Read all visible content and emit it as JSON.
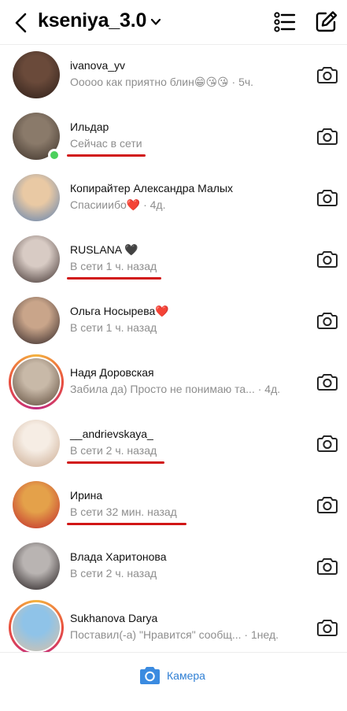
{
  "header": {
    "username": "kseniya_3.0",
    "back_icon": "chevron-left-icon",
    "list_icon": "list-icon",
    "compose_icon": "compose-icon"
  },
  "threads": [
    {
      "name": "ivanova_yv",
      "subtitle": "Ооооо как приятно блин😁😘😘 · 5ч.",
      "online": false,
      "story_ring": false,
      "underlined": false,
      "avatar_colors": [
        "#6a4a3a",
        "#2b1d18"
      ]
    },
    {
      "name": "Ильдар",
      "subtitle": "Сейчас в сети",
      "online": true,
      "story_ring": false,
      "underlined": true,
      "avatar_colors": [
        "#8a7a6a",
        "#3b3028"
      ]
    },
    {
      "name": "Копирайтер Александра Малых",
      "subtitle": "Спасииибо❤️ · 4д.",
      "online": false,
      "story_ring": false,
      "underlined": false,
      "avatar_colors": [
        "#e9c9a4",
        "#5a7fb1"
      ]
    },
    {
      "name": "RUSLANA 🖤",
      "subtitle": "В сети 1 ч. назад",
      "online": false,
      "story_ring": false,
      "underlined": true,
      "avatar_colors": [
        "#d8cbc4",
        "#3a2c2a"
      ]
    },
    {
      "name": "Ольга Носырева❤️",
      "subtitle": "В сети 1 ч. назад",
      "online": false,
      "story_ring": false,
      "underlined": false,
      "avatar_colors": [
        "#c9a58a",
        "#2d2224"
      ]
    },
    {
      "name": "Надя Доровская",
      "subtitle": "Забила да) Просто не понимаю та... · 4д.",
      "online": false,
      "story_ring": true,
      "underlined": false,
      "avatar_colors": [
        "#c8b9a8",
        "#5a4636"
      ]
    },
    {
      "name": "__andrievskaya_",
      "subtitle": "В сети 2 ч. назад",
      "online": false,
      "story_ring": false,
      "underlined": true,
      "avatar_colors": [
        "#f6ede4",
        "#c9a88e"
      ]
    },
    {
      "name": "Ирина",
      "subtitle": "В сети 32 мин. назад",
      "online": false,
      "story_ring": false,
      "underlined": true,
      "avatar_colors": [
        "#e4a14a",
        "#c0262a"
      ]
    },
    {
      "name": "Влада Харитонова",
      "subtitle": "В сети 2 ч. назад",
      "online": false,
      "story_ring": false,
      "underlined": false,
      "avatar_colors": [
        "#b9b4b2",
        "#1e1718"
      ]
    },
    {
      "name": "Sukhanova Darya",
      "subtitle": "Поставил(-а) \"Нравится\" сообщ... · 1нед.",
      "online": false,
      "story_ring": true,
      "underlined": false,
      "avatar_colors": [
        "#8fc3e8",
        "#d9c2a6"
      ]
    }
  ],
  "footer": {
    "camera_label": "Камера",
    "camera_color": "#2f7fd4"
  }
}
